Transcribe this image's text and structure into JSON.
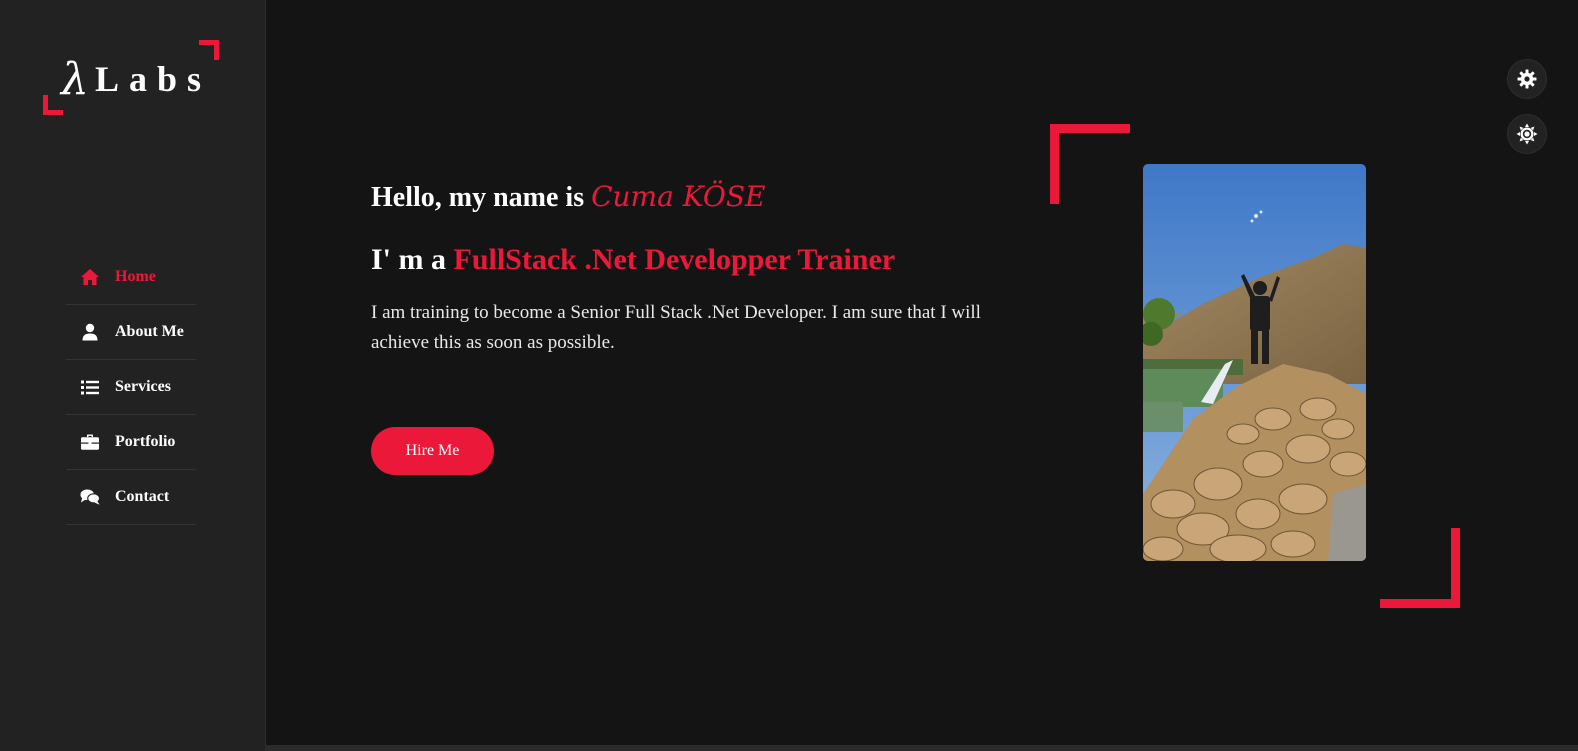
{
  "logo": {
    "lambda": "λ",
    "word": "Labs"
  },
  "nav": [
    {
      "label": "Home",
      "icon": "home-icon",
      "active": true
    },
    {
      "label": "About Me",
      "icon": "user-icon",
      "active": false
    },
    {
      "label": "Services",
      "icon": "list-icon",
      "active": false
    },
    {
      "label": "Portfolio",
      "icon": "briefcase-icon",
      "active": false
    },
    {
      "label": "Contact",
      "icon": "comments-icon",
      "active": false
    }
  ],
  "hero": {
    "greeting_prefix": "Hello, my name is ",
    "name": "Cuma KÖSE",
    "role_prefix": "I' m a ",
    "role": "FullStack .Net Developper Trainer",
    "description": "I am training to become a Senior Full Stack .Net Developer. I am sure that I will achieve this as soon as possible.",
    "button_label": "Hire Me"
  },
  "controls": {
    "settings_icon": "gear-icon",
    "theme_icon": "sun-icon"
  },
  "colors": {
    "accent": "#ec1839",
    "background": "#141414",
    "sidebar": "#222222"
  }
}
